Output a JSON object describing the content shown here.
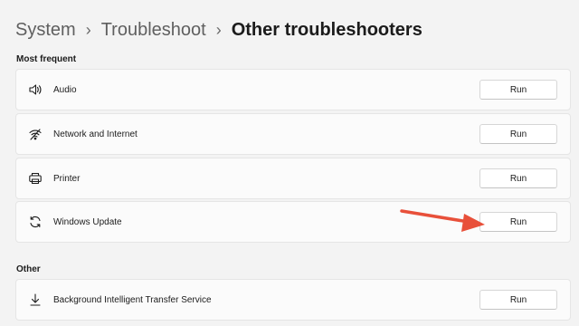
{
  "breadcrumb": {
    "items": [
      "System",
      "Troubleshoot"
    ],
    "current": "Other troubleshooters"
  },
  "sections": {
    "most_frequent_title": "Most frequent",
    "other_title": "Other"
  },
  "troubleshooters": [
    {
      "label": "Audio",
      "icon": "speaker-icon",
      "button": "Run"
    },
    {
      "label": "Network and Internet",
      "icon": "wifi-icon",
      "button": "Run"
    },
    {
      "label": "Printer",
      "icon": "printer-icon",
      "button": "Run"
    },
    {
      "label": "Windows Update",
      "icon": "refresh-icon",
      "button": "Run"
    }
  ],
  "other_troubleshooters": [
    {
      "label": "Background Intelligent Transfer Service",
      "icon": "download-icon",
      "button": "Run"
    }
  ],
  "annotation": {
    "color": "#e8503a",
    "target": "Windows Update Run button"
  }
}
